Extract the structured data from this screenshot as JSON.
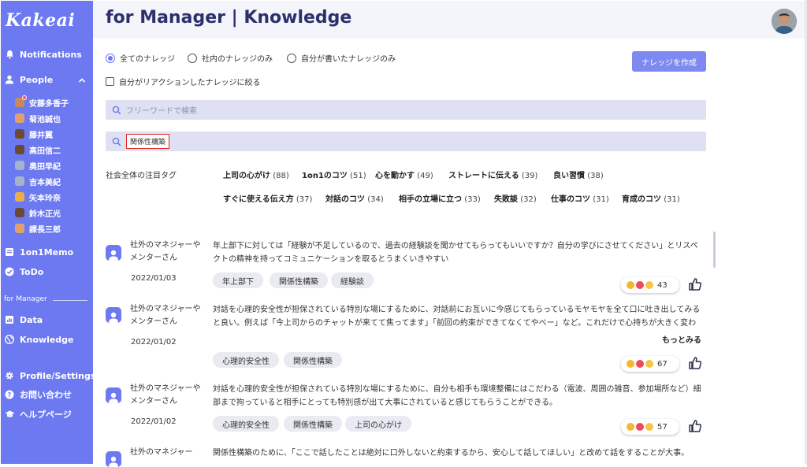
{
  "app": {
    "logo": "Kakeai",
    "page_title": "for Manager | Knowledge"
  },
  "sidebar": {
    "notifications": "Notifications",
    "people": "People",
    "persons": [
      "安藤多香子",
      "菊池誠也",
      "藤井翼",
      "高田信二",
      "奥田早紀",
      "吉本美紀",
      "矢本玲奈",
      "鈴木正光",
      "課長三郎"
    ],
    "memo": "1on1Memo",
    "todo": "ToDo",
    "section_label": "for Manager",
    "data": "Data",
    "knowledge": "Knowledge",
    "profile": "Profile/Settings",
    "contact": "お問い合わせ",
    "help": "ヘルプページ"
  },
  "filters": {
    "all": "全てのナレッジ",
    "internal": "社内のナレッジのみ",
    "mine": "自分が書いたナレッジのみ",
    "reacted": "自分がリアクションしたナレッジに絞る",
    "create": "ナレッジを作成"
  },
  "search": {
    "placeholder": "フリーワードで検索",
    "tag_value": "関係性構築"
  },
  "hot_tags": {
    "label": "社会全体の注目タグ",
    "items": [
      {
        "name": "上司の心がけ",
        "count": "(88)"
      },
      {
        "name": "1on1のコツ",
        "count": "(51)"
      },
      {
        "name": "心を動かす",
        "count": "(49)"
      },
      {
        "name": "ストレートに伝える",
        "count": "(39)"
      },
      {
        "name": "良い習慣",
        "count": "(38)"
      },
      {
        "name": "すぐに使える伝え方",
        "count": "(37)"
      },
      {
        "name": "対話のコツ",
        "count": "(34)"
      },
      {
        "name": "相手の立場に立つ",
        "count": "(33)"
      },
      {
        "name": "失敗談",
        "count": "(32)"
      },
      {
        "name": "仕事のコツ",
        "count": "(31)"
      },
      {
        "name": "育成のコツ",
        "count": "(31)"
      }
    ]
  },
  "posts": [
    {
      "author": "社外のマネジャーやメンターさん",
      "date": "2022/01/03",
      "text": "年上部下に対しては「経験が不足しているので、過去の経験談を聞かせてもらってもいいですか？自分の学びにさせてください」とリスペクトの精神を持ってコミュニケーションを取るとうまくいきやすい",
      "tags": [
        "年上部下",
        "関係性構築",
        "経験談"
      ],
      "reactions": "43"
    },
    {
      "author": "社外のマネジャーやメンターさん",
      "date": "2022/01/02",
      "text": "対話を心理的安全性が担保されている特別な場にするために、対話前にお互いに今感じてもらっているモヤモヤを全て口に吐き出してみると良い。例えば「今上司からのチャットが来てて焦ってます」「前回の約束ができてなくてやべー」など。これだけで心持ちが大きく変わります。",
      "tags": [
        "心理的安全性",
        "関係性構築"
      ],
      "more": "もっとみる",
      "reactions": "67"
    },
    {
      "author": "社外のマネジャーやメンターさん",
      "date": "2022/01/02",
      "text": "対話を心理的安全性が担保されている特別な場にするために、自分も相手も環境整備にはこだわる（電波、周囲の雑音、参加場所など）細部まで拘っていると相手にとっても特別感が出て大事にされていると感じてもらうことができる。",
      "tags": [
        "心理的安全性",
        "関係性構築",
        "上司の心がけ"
      ],
      "reactions": "57"
    },
    {
      "author": "社外のマネジャー",
      "text": "関係性構築のために、「ここで話したことは絶対に口外しないと約束するから、安心して話してほしい」と改めて話をすることが大事。"
    }
  ]
}
